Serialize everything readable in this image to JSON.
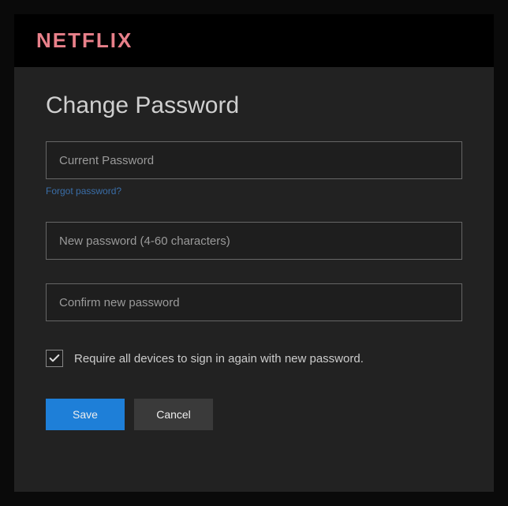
{
  "header": {
    "logo": "NETFLIX"
  },
  "page": {
    "title": "Change Password"
  },
  "fields": {
    "current_placeholder": "Current Password",
    "forgot_link": "Forgot password?",
    "new_placeholder": "New password (4-60 characters)",
    "confirm_placeholder": "Confirm new password"
  },
  "checkbox": {
    "checked": true,
    "label": "Require all devices to sign in again with new password."
  },
  "buttons": {
    "save": "Save",
    "cancel": "Cancel"
  }
}
